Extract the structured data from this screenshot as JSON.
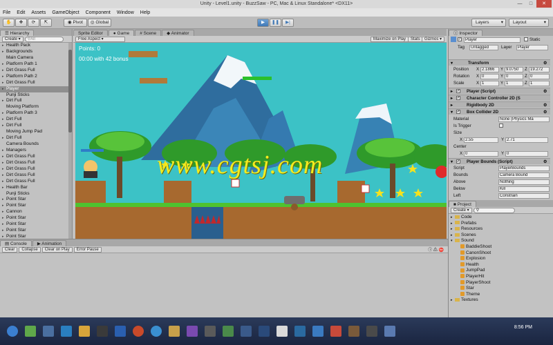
{
  "window": {
    "title": "Unity - Level1.unity - BuzzSaw - PC, Mac & Linux Standalone* <DX11>"
  },
  "menu": [
    "File",
    "Edit",
    "Assets",
    "GameObject",
    "Component",
    "Window",
    "Help"
  ],
  "toolbar": {
    "pivot": "Pivot",
    "global": "Global",
    "layers": "Layers",
    "layout": "Layout"
  },
  "hierarchy": {
    "tab": "Hierarchy",
    "create": "Create",
    "search_placeholder": "All",
    "items": [
      {
        "label": "Health Pack",
        "arrow": true
      },
      {
        "label": "Backgrounds",
        "arrow": true
      },
      {
        "label": "Main Camera",
        "arrow": false
      },
      {
        "label": "Platform Path 1",
        "arrow": true
      },
      {
        "label": "Dirt Grass Full",
        "arrow": true
      },
      {
        "label": "Platform Path 2",
        "arrow": true
      },
      {
        "label": "Dirt Grass Full",
        "arrow": true
      },
      {
        "label": "Player",
        "arrow": true,
        "selected": true
      },
      {
        "label": "Punji Sticks",
        "arrow": false
      },
      {
        "label": "Dirt Full",
        "arrow": true
      },
      {
        "label": "Moving Platform",
        "arrow": false
      },
      {
        "label": "Platform Path 3",
        "arrow": true
      },
      {
        "label": "Dirt Full",
        "arrow": true
      },
      {
        "label": "Dirt Full",
        "arrow": true
      },
      {
        "label": "Moving Jump Pad",
        "arrow": false
      },
      {
        "label": "Dirt Full",
        "arrow": true
      },
      {
        "label": "Camera Bounds",
        "arrow": false
      },
      {
        "label": "Managers",
        "arrow": true
      },
      {
        "label": "Dirt Grass Full",
        "arrow": true
      },
      {
        "label": "Dirt Grass Full",
        "arrow": true
      },
      {
        "label": "Dirt Grass Full",
        "arrow": true
      },
      {
        "label": "Dirt Grass Full",
        "arrow": true
      },
      {
        "label": "Dirt Grass Full",
        "arrow": true
      },
      {
        "label": "Health Bar",
        "arrow": true
      },
      {
        "label": "Punji Sticks",
        "arrow": false
      },
      {
        "label": "Point Star",
        "arrow": true
      },
      {
        "label": "Point Star",
        "arrow": true
      },
      {
        "label": "Cannon",
        "arrow": true
      },
      {
        "label": "Point Star",
        "arrow": true
      },
      {
        "label": "Point Star",
        "arrow": true
      },
      {
        "label": "Point Star",
        "arrow": true
      },
      {
        "label": "Point Star",
        "arrow": true
      }
    ]
  },
  "center_tabs": [
    "Sprite Editor",
    "Game",
    "Scene",
    "Animator"
  ],
  "game": {
    "aspect": "Free Aspect",
    "maximize": "Maximize on Play",
    "stats": "Stats",
    "gizmos": "Gizmos",
    "points": "Points: 0",
    "timer": "00:00 with 42 bonus"
  },
  "watermark": "www.cgtsj.com",
  "inspector": {
    "tab": "Inspector",
    "name": "Player",
    "static": "Static",
    "tag_label": "Tag",
    "tag_value": "Untagged",
    "layer_label": "Layer",
    "layer_value": "Player",
    "transform": "Transform",
    "position": {
      "label": "Position",
      "x": "2.1866",
      "y": "9.0750",
      "z": "19.272"
    },
    "rotation": {
      "label": "Rotation",
      "x": "0",
      "y": "0",
      "z": "0"
    },
    "scale": {
      "label": "Scale",
      "x": "1",
      "y": "1",
      "z": "1"
    },
    "player_script": "Player (Script)",
    "char_controller": "Character Controller 2D (S",
    "rigidbody": "Rigidbody 2D",
    "box_collider": "Box Collider 2D",
    "material": {
      "label": "Material",
      "value": "None (Physics Ma"
    },
    "is_trigger": "Is Trigger",
    "size": {
      "label": "Size",
      "x": "2.55",
      "y": "2.71"
    },
    "center": {
      "label": "Center",
      "x": "0",
      "y": "0"
    },
    "player_bounds": "Player Bounds (Script)",
    "script": {
      "label": "Script",
      "value": "PlayerBounds"
    },
    "bounds": {
      "label": "Bounds",
      "value": "Camera Bound"
    },
    "above": {
      "label": "Above",
      "value": "Nothing"
    },
    "below": {
      "label": "Below",
      "value": "Kill"
    },
    "left": {
      "label": "Left",
      "value": "Constrain"
    }
  },
  "project": {
    "tab": "Project",
    "create": "Create",
    "folders": [
      "Code",
      "Prefabs",
      "Resources",
      "Scenes",
      "Sound"
    ],
    "sounds": [
      "BaddieShoot",
      "CanonShoot",
      "Explosion",
      "Health",
      "JumpPad",
      "PlayerHit",
      "PlayerShoot",
      "Star",
      "Theme"
    ],
    "last": "Textures"
  },
  "console": {
    "tabs": [
      "Console",
      "Animation"
    ],
    "buttons": [
      "Clear",
      "Collapse",
      "Clear on Play",
      "Error Pause"
    ]
  },
  "taskbar": {
    "time": "8:56 PM"
  },
  "colors": {
    "sky": "#3cc2c6",
    "selection": "#8f8f8f",
    "play_blue": "#3f78b6"
  }
}
